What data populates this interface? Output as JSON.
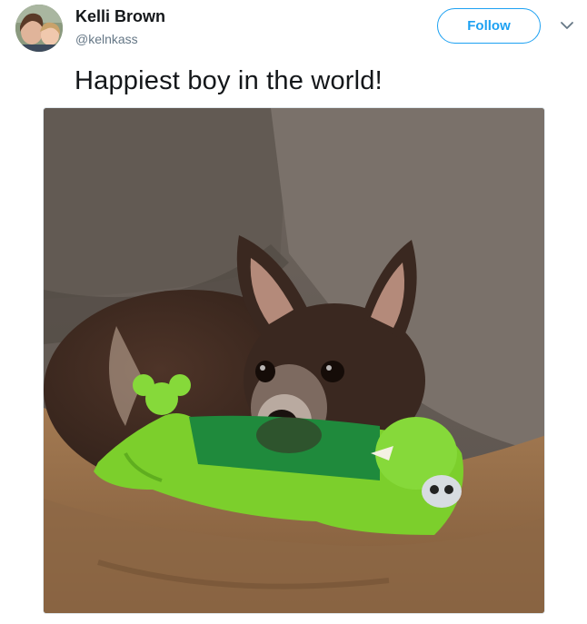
{
  "tweet": {
    "author": {
      "display_name": "Kelli Brown",
      "handle": "@kelnkass"
    },
    "follow_label": "Follow",
    "text": "Happiest boy in the world!"
  },
  "media": {
    "description_icon": "photo"
  },
  "colors": {
    "accent": "#1da1f2",
    "secondary_text": "#657786",
    "primary_text": "#14171a"
  }
}
